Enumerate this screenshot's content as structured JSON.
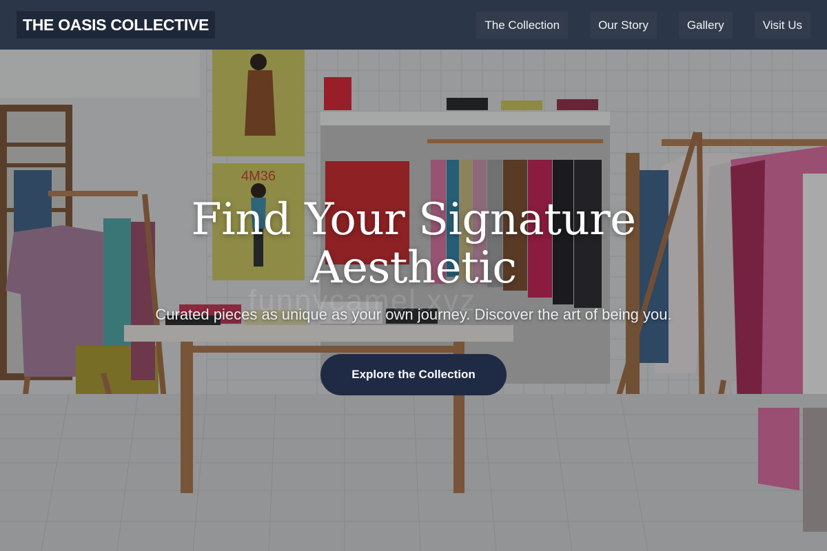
{
  "brand": {
    "name": "THE OASIS COLLECTIVE"
  },
  "nav": {
    "items": [
      {
        "label": "The Collection"
      },
      {
        "label": "Our Story"
      },
      {
        "label": "Gallery"
      },
      {
        "label": "Visit Us"
      }
    ]
  },
  "hero": {
    "title": "Find Your Signature Aesthetic",
    "subtitle": "Curated pieces as unique as your own journey. Discover the art of being you.",
    "cta_label": "Explore the Collection",
    "watermark": "funnycamel.xyz",
    "poster_labels": [
      "4M36",
      "4M36"
    ]
  },
  "colors": {
    "nav_bg": "#2b3648",
    "logo_bg": "#1f2838",
    "nav_button_bg": "#323c4c",
    "cta_bg": "#1f2b45",
    "text": "#ffffff"
  }
}
